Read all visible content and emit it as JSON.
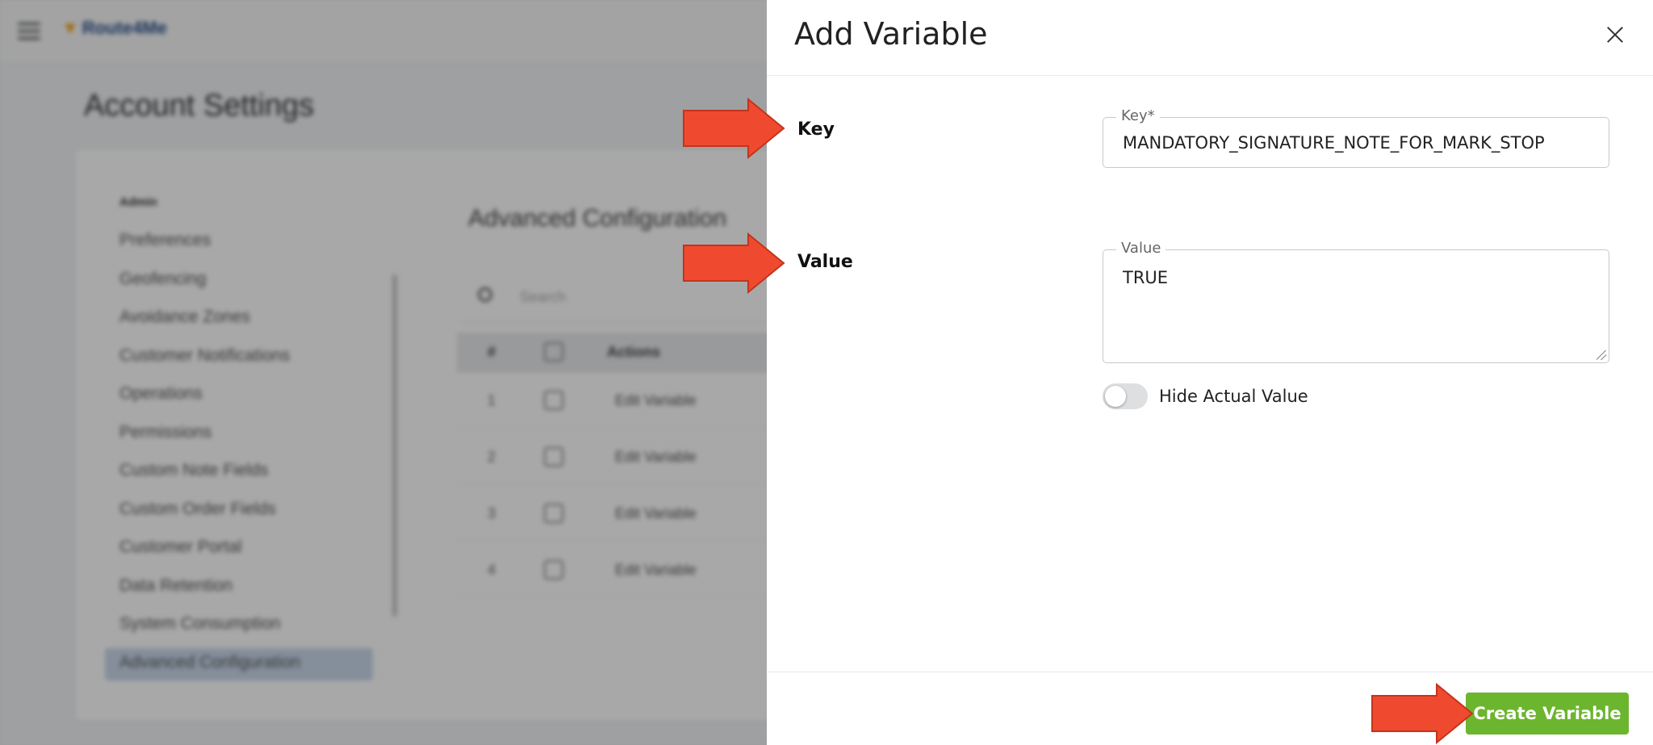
{
  "background": {
    "logo_text": "Route4Me",
    "page_title": "Account Settings",
    "sidebar": {
      "header": "Admin",
      "items": [
        "Preferences",
        "Geofencing",
        "Avoidance Zones",
        "Customer Notifications",
        "Operations",
        "Permissions",
        "Custom Note Fields",
        "Custom Order Fields",
        "Customer Portal",
        "Data Retention",
        "System Consumption",
        "Advanced Configuration"
      ],
      "active_item": "Advanced Configuration"
    },
    "section_title": "Advanced Configuration",
    "search_placeholder": "Search",
    "table": {
      "columns": [
        "#",
        "",
        "Actions"
      ],
      "rows": [
        {
          "num": "1",
          "action": "Edit Variable"
        },
        {
          "num": "2",
          "action": "Edit Variable"
        },
        {
          "num": "3",
          "action": "Edit Variable"
        },
        {
          "num": "4",
          "action": "Edit Variable"
        }
      ]
    }
  },
  "dialog": {
    "title": "Add Variable",
    "close_icon": "close-icon",
    "key": {
      "label": "Key",
      "legend": "Key*",
      "value": "MANDATORY_SIGNATURE_NOTE_FOR_MARK_STOP"
    },
    "value": {
      "label": "Value",
      "legend": "Value",
      "value": "TRUE"
    },
    "hide_toggle": {
      "label": "Hide Actual Value",
      "checked": false
    },
    "submit_label": "Create Variable"
  },
  "colors": {
    "primary_button": "#6cb52f",
    "annotation_arrow": "#ef4a2f",
    "overlay": "rgba(0,0,0,0.34)"
  }
}
